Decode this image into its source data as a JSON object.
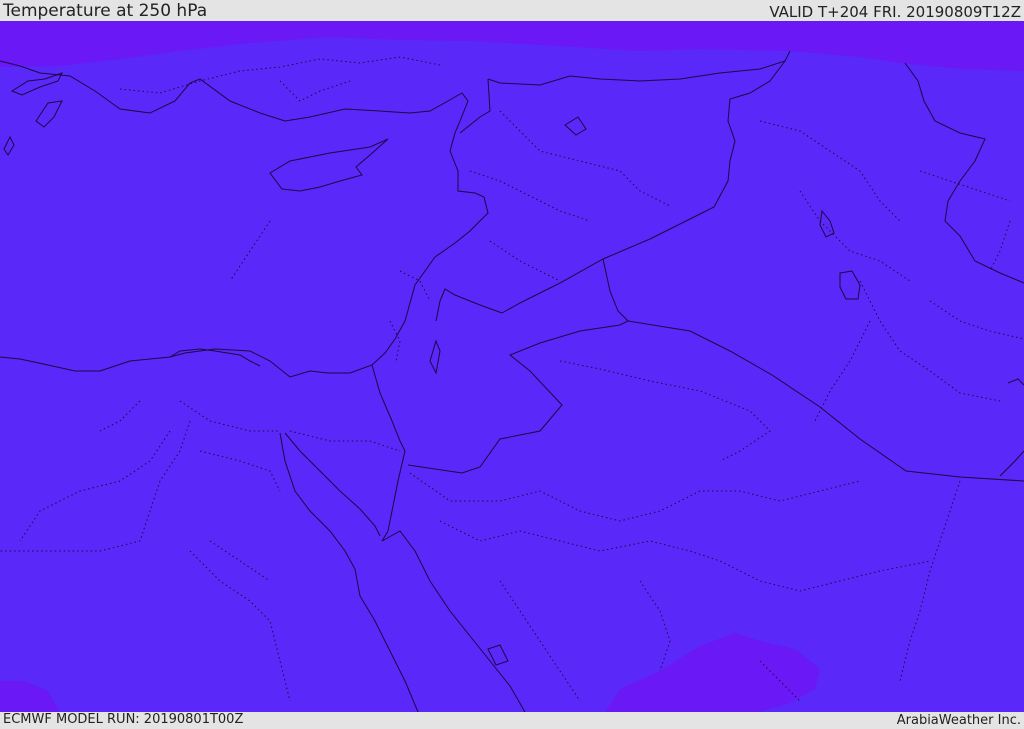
{
  "header": {
    "title": "Temperature at 250 hPa",
    "valid": "VALID T+204 FRI. 20190809T12Z"
  },
  "footer": {
    "model_run": "ECMWF MODEL RUN: 20190801T00Z",
    "credit": "ArabiaWeather Inc."
  },
  "map": {
    "field": "temperature",
    "level": "250 hPa",
    "colors": {
      "field_main": "#5a28f8",
      "field_cold": "#6a18f6",
      "coastline": "#1a0a44",
      "boundary": "#1a0a44"
    }
  }
}
